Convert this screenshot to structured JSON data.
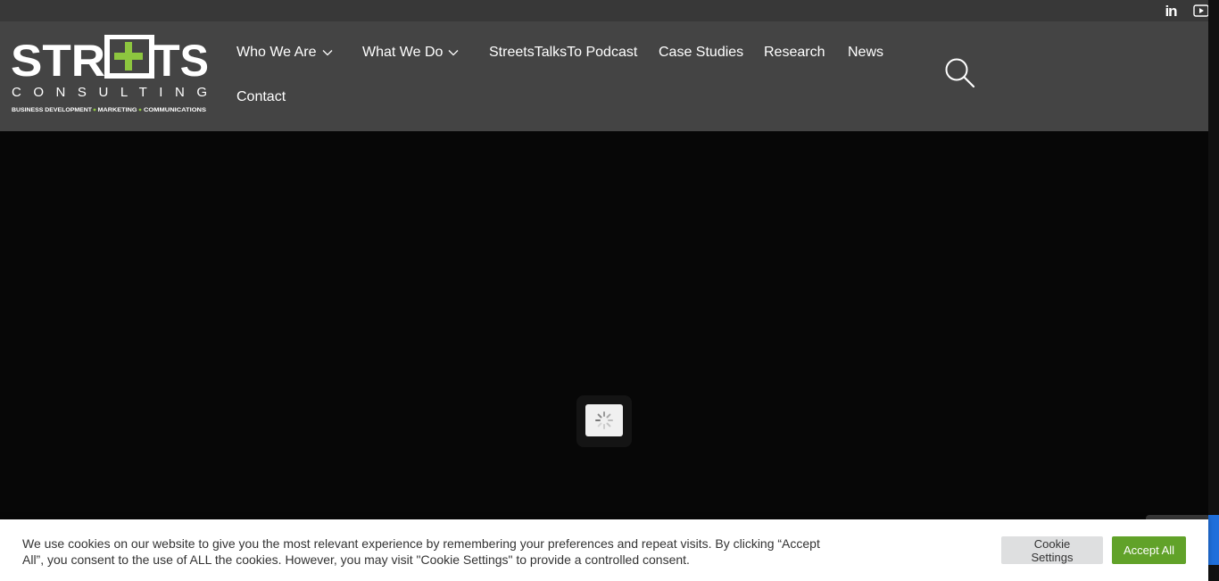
{
  "topbar": {
    "social": [
      {
        "name": "linkedin-icon",
        "glyph": "in"
      },
      {
        "name": "youtube-icon",
        "glyph": ""
      }
    ]
  },
  "logo": {
    "wordmark": "STREETS",
    "sub": "CONSULTING",
    "tagline_parts": [
      "BUSINESS DEVELOPMENT",
      "MARKETING",
      "COMMUNICATIONS"
    ],
    "accent": "#8dc63f"
  },
  "nav": {
    "items": [
      {
        "label": "Who We Are",
        "dropdown": true
      },
      {
        "label": "What We Do",
        "dropdown": true
      },
      {
        "label": "StreetsTalksTo Podcast",
        "dropdown": false
      },
      {
        "label": "Case Studies",
        "dropdown": false
      },
      {
        "label": "Research",
        "dropdown": false
      },
      {
        "label": "News",
        "dropdown": false
      },
      {
        "label": "Contact",
        "dropdown": false
      }
    ]
  },
  "cookie": {
    "text": "We use cookies on our website to give you the most relevant experience by remembering your preferences and repeat visits. By clicking “Accept All”, you consent to the use of ALL the cookies. However, you may visit \"Cookie Settings\" to provide a controlled consent.",
    "settings_label": "Cookie Settings",
    "accept_label": "Accept All",
    "accept_color": "#61a229"
  },
  "colors": {
    "header_bg": "#444444",
    "topbar_bg": "#383838",
    "hero_bg": "#070707"
  }
}
